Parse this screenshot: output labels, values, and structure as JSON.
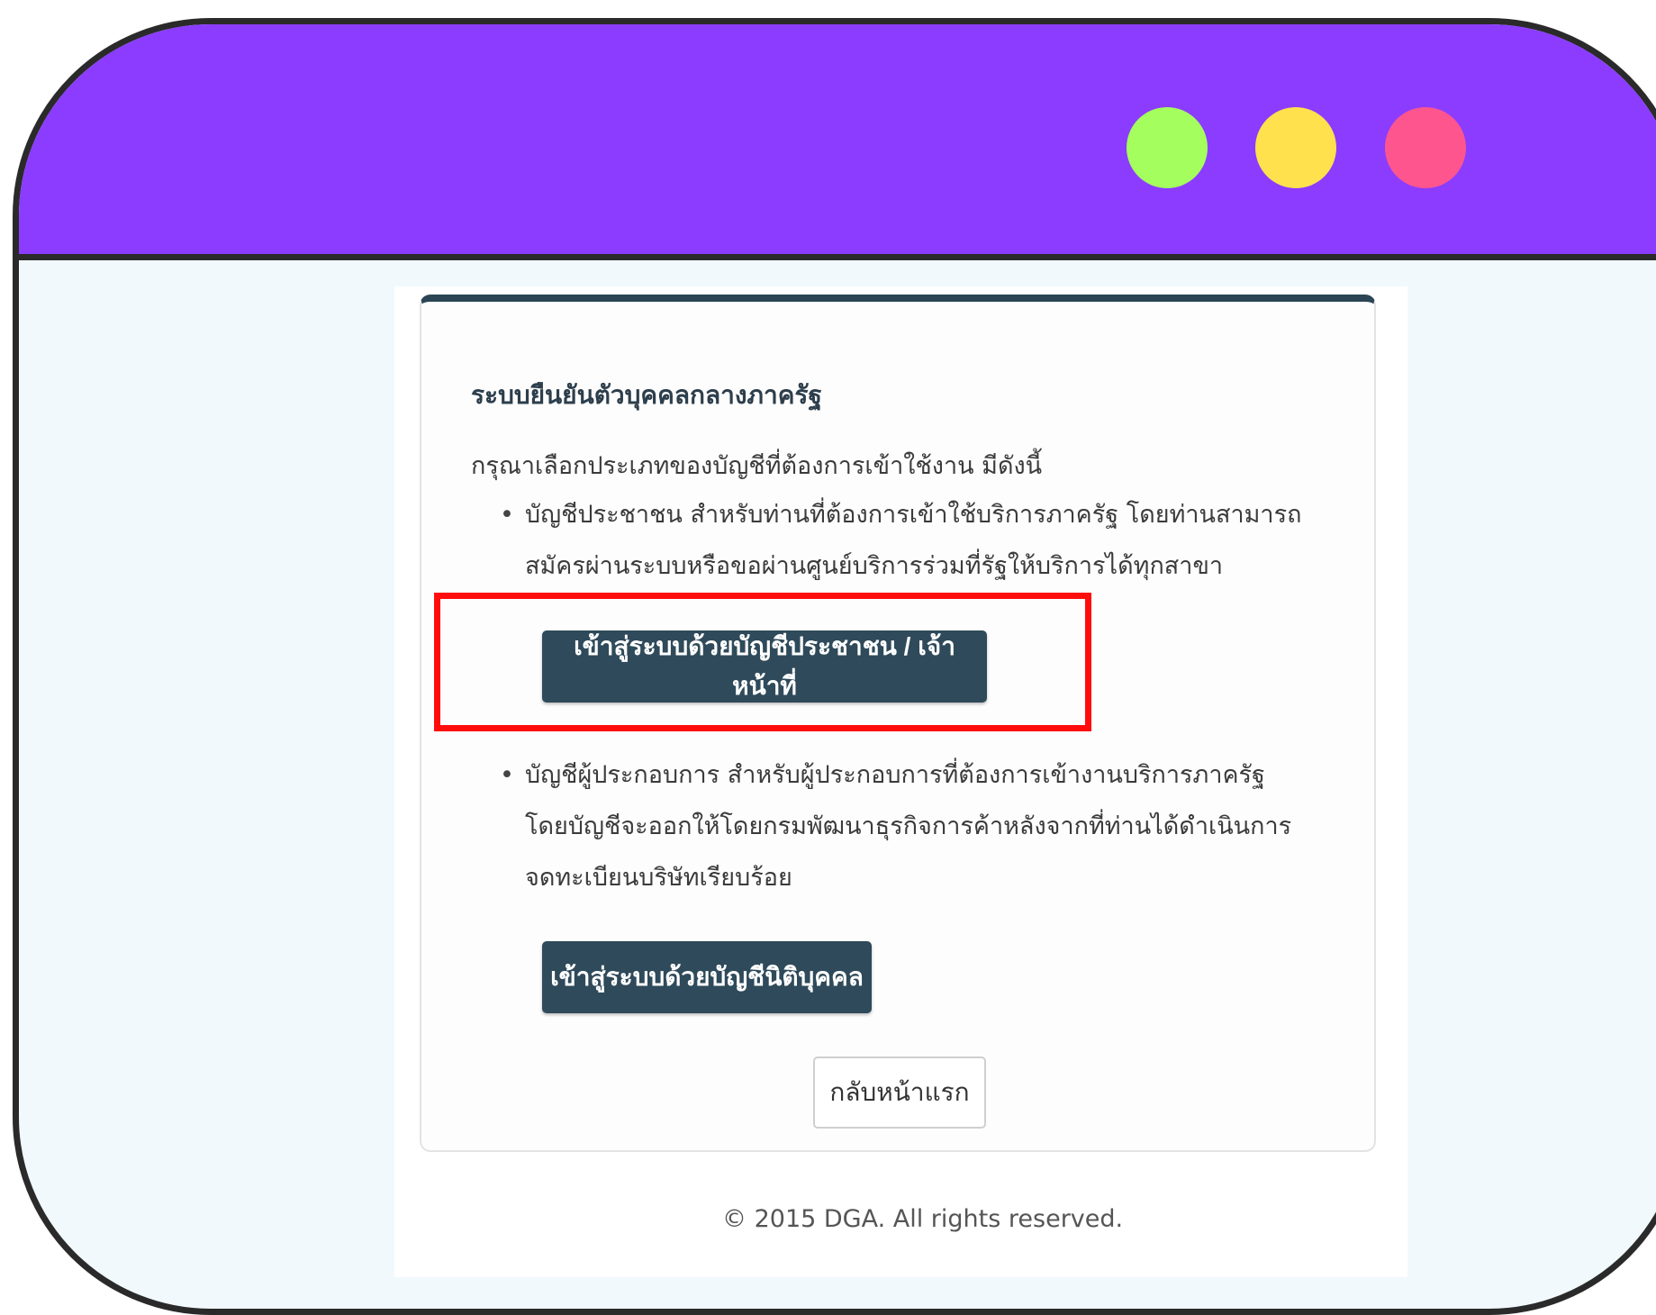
{
  "window": {
    "controls": {
      "green": "#a4ff5e",
      "yellow": "#ffe14d",
      "red": "#ff558e"
    },
    "title_bar_color": "#8b3cff"
  },
  "panel": {
    "heading": "ระบบยืนยันตัวบุคคลกลางภาครัฐ",
    "intro": "กรุณาเลือกประเภทของบัญชีที่ต้องการเข้าใช้งาน มีดังนี้",
    "citizen": {
      "description": "บัญชีประชาชน สำหรับท่านที่ต้องการเข้าใช้บริการภาครัฐ โดยท่านสามารถสมัครผ่านระบบหรือขอผ่านศูนย์บริการร่วมที่รัฐให้บริการได้ทุกสาขา",
      "button_label": "เข้าสู่ระบบด้วยบัญชีประชาชน / เจ้าหน้าที่"
    },
    "juristic": {
      "description": "บัญชีผู้ประกอบการ สำหรับผู้ประกอบการที่ต้องการเข้างานบริการภาครัฐ โดยบัญชีจะออกให้โดยกรมพัฒนาธุรกิจการค้าหลังจากที่ท่านได้ดำเนินการจดทะเบียนบริษัทเรียบร้อย",
      "button_label": "เข้าสู่ระบบด้วยบัญชีนิติบุคคล"
    },
    "back_button": "กลับหน้าแรก"
  },
  "footer": "© 2015 DGA. All rights reserved.",
  "colors": {
    "button_dark": "#2f4a5a",
    "highlight_box": "#ff0d0d"
  }
}
